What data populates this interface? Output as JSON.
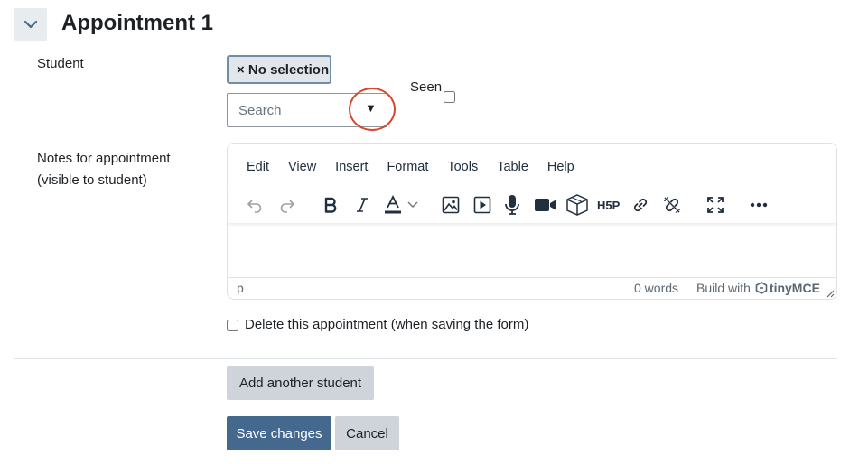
{
  "section": {
    "title": "Appointment 1"
  },
  "student": {
    "label": "Student",
    "selection_chip": "× No selection",
    "search_placeholder": "Search",
    "dropdown_arrow": "▼"
  },
  "seen": {
    "label": "Seen",
    "checked": false
  },
  "notes": {
    "label_line1": "Notes for appointment",
    "label_line2": "(visible to student)"
  },
  "editor": {
    "menus": [
      "Edit",
      "View",
      "Insert",
      "Format",
      "Tools",
      "Table",
      "Help"
    ],
    "toolbar_icons": [
      "undo-icon",
      "redo-icon",
      "bold-icon",
      "italic-icon",
      "text-color-icon",
      "text-color-dropdown-icon",
      "image-icon",
      "media-icon",
      "microphone-icon",
      "video-camera-icon",
      "3d-box-icon",
      "h5p-icon",
      "link-icon",
      "unlink-icon",
      "fullscreen-icon",
      "more-icon"
    ],
    "status_path": "p",
    "word_count": "0 words",
    "build_with": "Build with",
    "brand": "tinyMCE"
  },
  "delete": {
    "label": "Delete this appointment (when saving the form)",
    "checked": false
  },
  "buttons": {
    "add_student": "Add another student",
    "save": "Save changes",
    "cancel": "Cancel"
  },
  "colors": {
    "primary": "#45698e",
    "secondary": "#ced4da",
    "highlight_circle": "#d9452f"
  }
}
